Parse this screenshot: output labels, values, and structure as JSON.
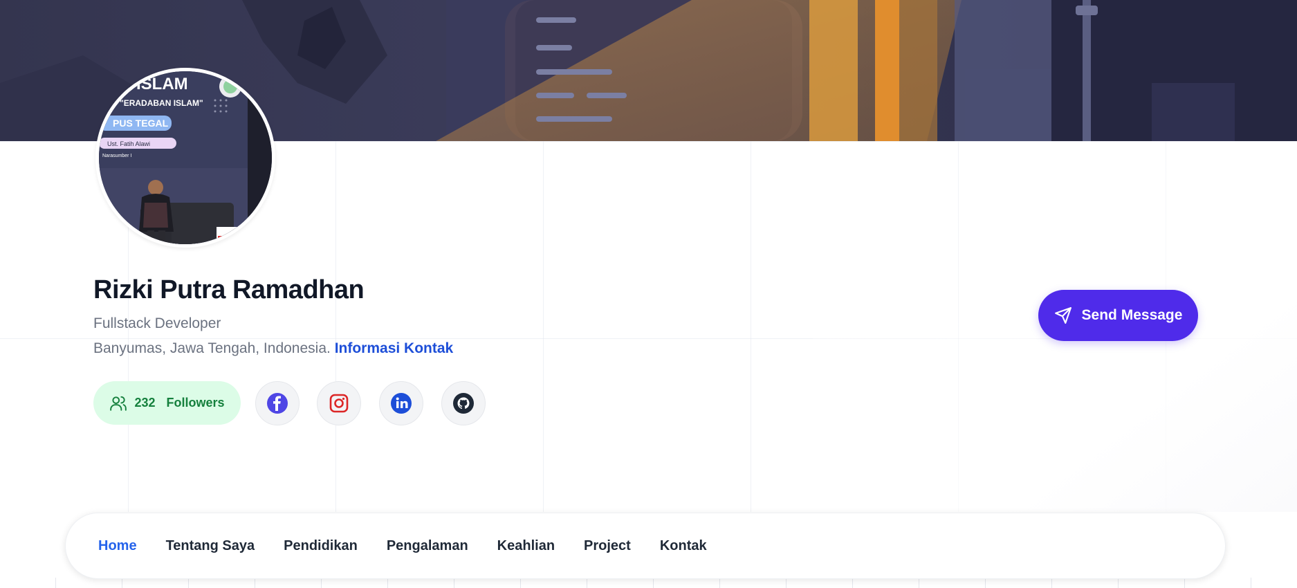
{
  "profile": {
    "name": "Rizki Putra Ramadhan",
    "role": "Fullstack Developer",
    "location": "Banyumas, Jawa Tengah, Indonesia.",
    "contact_link": "Informasi Kontak",
    "avatar_text": {
      "line1": "N ISLAM",
      "line2": "\"ERADABAN ISLAM\"",
      "line3": "PUS TEGAL",
      "line4": "Ust. Fatih Alawi",
      "line5": "Narasumber I"
    }
  },
  "followers": {
    "count": "232",
    "label": "Followers"
  },
  "socials": [
    {
      "name": "facebook",
      "icon": "facebook-icon",
      "color": "#4f46e5"
    },
    {
      "name": "instagram",
      "icon": "instagram-icon",
      "color": "#dc2626"
    },
    {
      "name": "linkedin",
      "icon": "linkedin-icon",
      "color": "#1d4ed8"
    },
    {
      "name": "github",
      "icon": "github-icon",
      "color": "#1f2937"
    }
  ],
  "actions": {
    "send_message": "Send Message"
  },
  "nav": {
    "items": [
      {
        "label": "Home",
        "active": true
      },
      {
        "label": "Tentang Saya",
        "active": false
      },
      {
        "label": "Pendidikan",
        "active": false
      },
      {
        "label": "Pengalaman",
        "active": false
      },
      {
        "label": "Keahlian",
        "active": false
      },
      {
        "label": "Project",
        "active": false
      },
      {
        "label": "Kontak",
        "active": false
      }
    ]
  },
  "colors": {
    "accent": "#4f2bea",
    "link": "#1d4ed8",
    "nav_active": "#2563eb",
    "followers_bg": "#dcfce7",
    "followers_text": "#15803d"
  }
}
